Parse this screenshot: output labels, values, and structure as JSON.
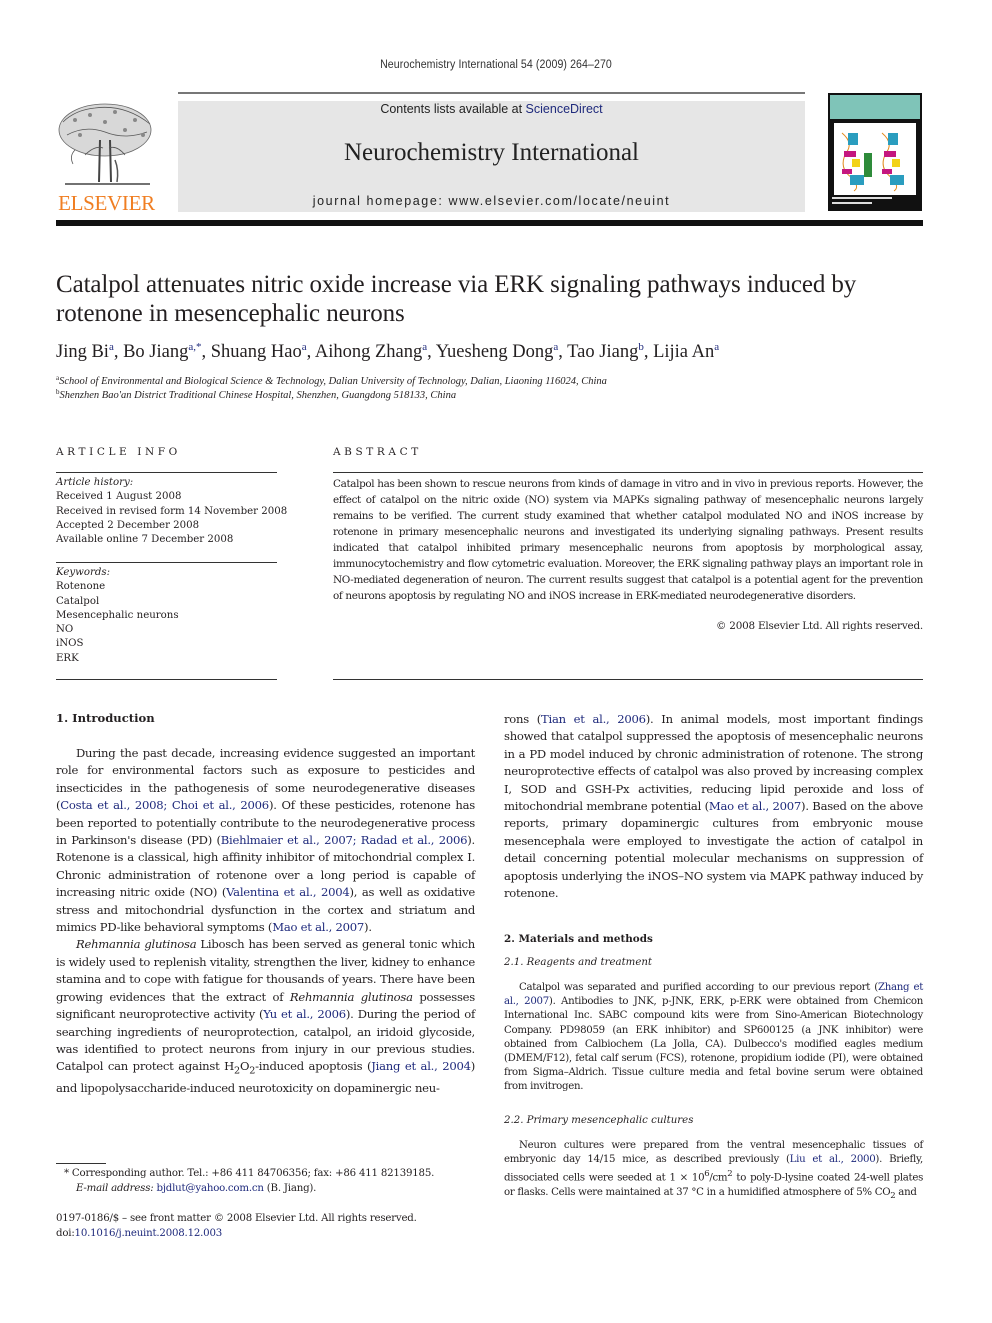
{
  "running_head": "Neurochemistry International 54 (2009) 264–270",
  "banner": {
    "publisher": "ELSEVIER",
    "contents_prefix": "Contents lists available at ",
    "contents_link": "ScienceDirect",
    "journal_name": "Neurochemistry International",
    "homepage": "journal homepage: www.elsevier.com/locate/neuint",
    "colors": {
      "publisher_orange": "#f07e22",
      "link_blue": "#1f2a7c",
      "banner_gray": "#e6e6e6",
      "cover_teal": "#7fc4b8"
    }
  },
  "article": {
    "title": "Catalpol attenuates nitric oxide increase via ERK signaling pathways induced by rotenone in mesencephalic neurons",
    "authors": [
      {
        "name": "Jing Bi",
        "sup": "a"
      },
      {
        "name": "Bo Jiang",
        "sup": "a,*"
      },
      {
        "name": "Shuang Hao",
        "sup": "a"
      },
      {
        "name": "Aihong Zhang",
        "sup": "a"
      },
      {
        "name": "Yuesheng Dong",
        "sup": "a"
      },
      {
        "name": "Tao Jiang",
        "sup": "b"
      },
      {
        "name": "Lijia An",
        "sup": "a"
      }
    ],
    "affiliations": [
      {
        "sup": "a",
        "text": "School of Environmental and Biological Science & Technology, Dalian University of Technology, Dalian, Liaoning 116024, China"
      },
      {
        "sup": "b",
        "text": "Shenzhen Bao'an District Traditional Chinese Hospital, Shenzhen, Guangdong 518133, China"
      }
    ]
  },
  "article_info": {
    "label": "ARTICLE INFO",
    "history_label": "Article history:",
    "history": [
      "Received 1 August 2008",
      "Received in revised form 14 November 2008",
      "Accepted 2 December 2008",
      "Available online 7 December 2008"
    ],
    "keywords_label": "Keywords:",
    "keywords": [
      "Rotenone",
      "Catalpol",
      "Mesencephalic neurons",
      "NO",
      "iNOS",
      "ERK"
    ]
  },
  "abstract": {
    "label": "ABSTRACT",
    "text": "Catalpol has been shown to rescue neurons from kinds of damage in vitro and in vivo in previous reports. However, the effect of catalpol on the nitric oxide (NO) system via MAPKs signaling pathway of mesencephalic neurons largely remains to be verified. The current study examined that whether catalpol modulated NO and iNOS increase by rotenone in primary mesencephalic neurons and investigated its underlying signaling pathways. Present results indicated that catalpol inhibited primary mesencephalic neurons from apoptosis by morphological assay, immunocytochemistry and flow cytometric evaluation. Moreover, the ERK signaling pathway plays an important role in NO-mediated degeneration of neuron. The current results suggest that catalpol is a potential agent for the prevention of neurons apoptosis by regulating NO and iNOS increase in ERK-mediated neurodegenerative disorders.",
    "copyright": "© 2008 Elsevier Ltd. All rights reserved."
  },
  "intro": {
    "heading": "1. Introduction",
    "p1": [
      "During the past decade, increasing evidence suggested an important role for environmental factors such as exposure to pesticides and insecticides in the pathogenesis of some neurodegenerative diseases (",
      "Costa et al., 2008; Choi et al., 2006",
      "). Of these pesticides, rotenone has been reported to potentially contribute to the neurodegenerative process in Parkinson's disease (PD) (",
      "Biehlmaier et al., 2007; Radad et al., 2006",
      "). Rotenone is a classical, high affinity inhibitor of mitochondrial complex I. Chronic administration of rotenone over a long period is capable of increasing nitric oxide (NO) (",
      "Valentina et al., 2004",
      "), as well as oxidative stress and mitochondrial dysfunction in the cortex and striatum and mimics PD-like behavioral symptoms (",
      "Mao et al., 2007",
      ")."
    ],
    "p2": {
      "species": "Rehmannia glutinosa",
      "t1": " Libosch has been served as general tonic which is widely used to replenish vitality, strengthen the liver, kidney to enhance stamina and to cope with fatigue for thousands of years. There have been growing evidences that the extract of ",
      "species2": "Rehmannia glutinosa",
      "t2": " possesses significant neuroprotective activity (",
      "ref1": "Yu et al., 2006",
      "t3": "). During the period of searching ingredients of neuroprotection, catalpol, an iridoid glycoside, was identified to protect neurons from injury in our previous studies. Catalpol can protect against H",
      "sub1": "2",
      "t3b": "O",
      "sub2": "2",
      "t4": "-induced apoptosis (",
      "ref2": "Jiang et al., 2004",
      "t5": ") and lipopolysaccharide-induced neurotoxicity on dopaminergic neu-"
    },
    "p3": [
      "rons (",
      "Tian et al., 2006",
      "). In animal models, most important findings showed that catalpol suppressed the apoptosis of mesencephalic neurons in a PD model induced by chronic administration of rotenone. The strong neuroprotective effects of catalpol was also proved by increasing complex I, SOD and GSH-Px activities, reducing lipid peroxide and loss of mitochondrial membrane potential (",
      "Mao et al., 2007",
      "). Based on the above reports, primary dopaminergic cultures from embryonic mouse mesencephala were employed to investigate the action of catalpol in detail concerning potential molecular mechanisms on suppression of apoptosis underlying the iNOS–NO system via MAPK pathway induced by rotenone."
    ]
  },
  "methods": {
    "heading": "2. Materials and methods",
    "sub1": "2.1. Reagents and treatment",
    "sub1_text": [
      "Catalpol was separated and purified according to our previous report (",
      "Zhang et al., 2007",
      "). Antibodies to JNK, p-JNK, ERK, p-ERK were obtained from Chemicon International Inc. SABC compound kits were from Sino-American Biotechnology Company. PD98059 (an ERK inhibitor) and SP600125 (a JNK inhibitor) were obtained from Calbiochem (La Jolla, CA). Dulbecco's modified eagles medium (DMEM/F12), fetal calf serum (FCS), rotenone, propidium iodide (PI), were obtained from Sigma–Aldrich. Tissue culture media and fetal bovine serum were obtained from invitrogen."
    ],
    "sub2": "2.2. Primary mesencephalic cultures",
    "sub2_text": {
      "t1": "Neuron cultures were prepared from the ventral mesencephalic tissues of embryonic day 14/15 mice, as described previously (",
      "ref": "Liu et al., 2000",
      "t2": "). Briefly, dissociated cells were seeded at 1 × 10",
      "sup1": "6",
      "t3": "/cm",
      "sup2": "2",
      "t4": " to poly-D-lysine coated 24-well plates or flasks. Cells were maintained at 37 °C in a humidified atmosphere of 5% CO",
      "sub": "2",
      "t5": " and"
    }
  },
  "footnotes": {
    "corresponding": "* Corresponding author. Tel.: +86 411 84706356; fax: +86 411 82139185.",
    "email_label": "E-mail address: ",
    "email": "bjdlut@yahoo.com.cn",
    "email_suffix": " (B. Jiang).",
    "front_matter": "0197-0186/$ – see front matter © 2008 Elsevier Ltd. All rights reserved.",
    "doi_prefix": "doi:",
    "doi": "10.1016/j.neuint.2008.12.003"
  }
}
